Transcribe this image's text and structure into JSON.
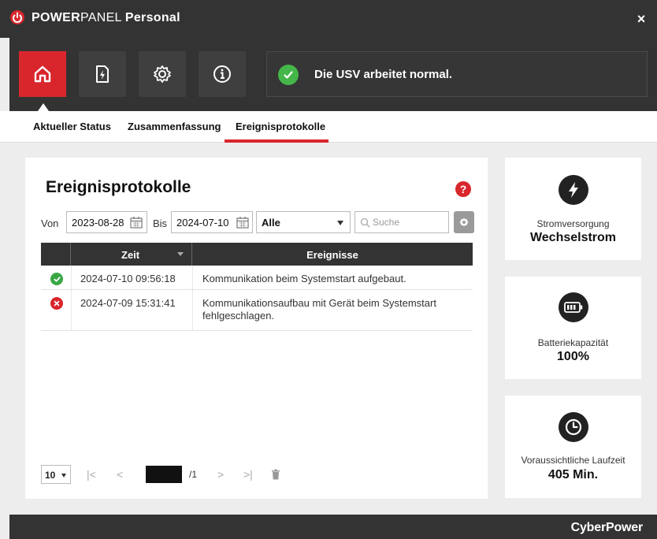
{
  "app": {
    "title_part1": "POWER",
    "title_part2": "PANEL",
    "title_part3": "Personal",
    "close_label": "×"
  },
  "nav": {
    "items": [
      {
        "name": "home",
        "icon": "home-icon",
        "active": true
      },
      {
        "name": "power",
        "icon": "power-document-icon",
        "active": false
      },
      {
        "name": "settings",
        "icon": "gear-icon",
        "active": false
      },
      {
        "name": "info",
        "icon": "info-icon",
        "active": false
      }
    ]
  },
  "status": {
    "text": "Die USV arbeitet normal.",
    "icon": "check-circle-icon",
    "color": "#45b649"
  },
  "tabs": [
    {
      "label": "Aktueller Status"
    },
    {
      "label": "Zusammenfassung"
    },
    {
      "label": "Ereignisprotokolle",
      "active": true
    }
  ],
  "main": {
    "title": "Ereignisprotokolle",
    "help_label": "?",
    "filter": {
      "from_label": "Von",
      "from_value": "2023-08-28",
      "to_label": "Bis",
      "to_value": "2024-07-10",
      "type_value": "Alle",
      "search_placeholder": "Suche"
    },
    "table": {
      "headers": {
        "time": "Zeit",
        "events": "Ereignisse"
      },
      "rows": [
        {
          "status": "ok",
          "time": "2024-07-10 09:56:18",
          "event": "Kommunikation beim Systemstart aufgebaut."
        },
        {
          "status": "error",
          "time": "2024-07-09 15:31:41",
          "event": "Kommunikationsaufbau mit Gerät beim Systemstart fehlgeschlagen."
        }
      ]
    },
    "pager": {
      "per_page": "10",
      "first": "|<",
      "prev": "<",
      "page": "1",
      "total": "/1",
      "next": ">",
      "last": ">|"
    }
  },
  "cards": {
    "power": {
      "label": "Stromversorgung",
      "value": "Wechselstrom",
      "icon": "lightning-icon"
    },
    "battery": {
      "label": "Batteriekapazität",
      "value": "100%",
      "icon": "battery-icon"
    },
    "runtime": {
      "label": "Voraussichtliche Laufzeit",
      "value": "405 Min.",
      "icon": "clock-icon"
    }
  },
  "footer": {
    "brand": "CyberPower"
  },
  "colors": {
    "accent": "#d9262c",
    "dark": "#333333",
    "ok": "#3aa745"
  }
}
